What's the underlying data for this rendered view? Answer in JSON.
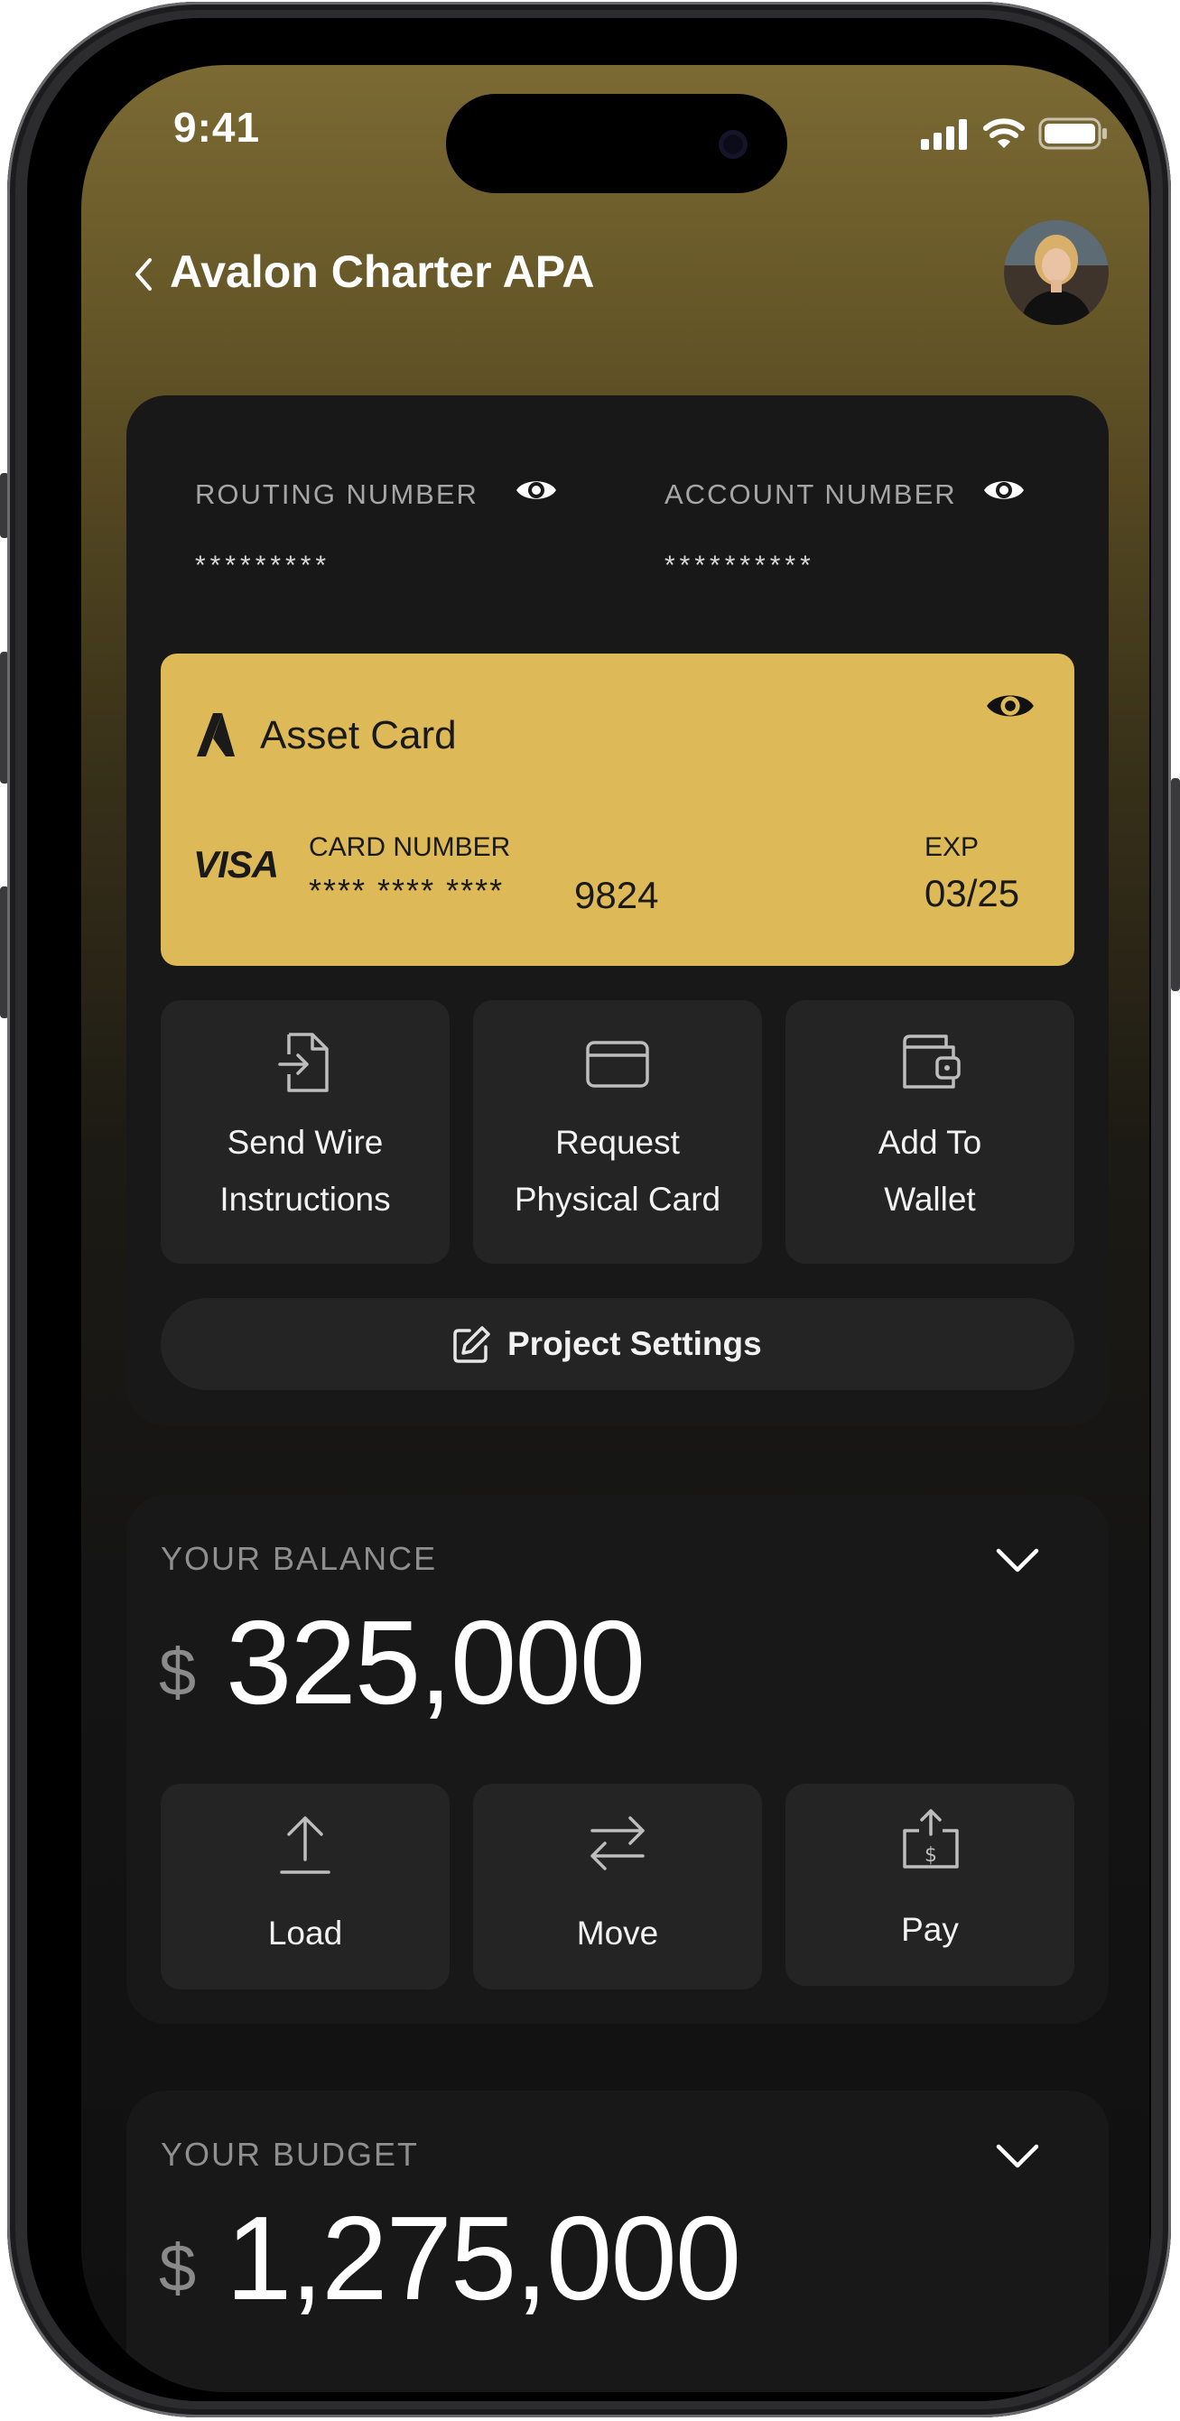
{
  "status_bar": {
    "time": "9:41"
  },
  "header": {
    "title": "Avalon Charter APA"
  },
  "account": {
    "routing_label": "ROUTING NUMBER",
    "routing_value": "*********",
    "account_label": "ACCOUNT NUMBER",
    "account_value": "**********"
  },
  "card": {
    "name": "Asset Card",
    "brand": "VISA",
    "number_label": "CARD NUMBER",
    "number_masked": "**** **** ****",
    "number_last4": "9824",
    "exp_label": "EXP",
    "exp_value": "03/25",
    "color": "#ddba57"
  },
  "card_actions": [
    {
      "label_line1": "Send Wire",
      "label_line2": "Instructions",
      "icon": "file-export-icon"
    },
    {
      "label_line1": "Request",
      "label_line2": "Physical Card",
      "icon": "credit-card-icon"
    },
    {
      "label_line1": "Add To",
      "label_line2": "Wallet",
      "icon": "wallet-icon"
    }
  ],
  "project_settings": {
    "label": "Project Settings",
    "icon": "edit-icon"
  },
  "balance": {
    "label": "YOUR BALANCE",
    "currency": "$",
    "amount": "325,000",
    "actions": [
      {
        "label": "Load",
        "icon": "upload-arrow-icon"
      },
      {
        "label": "Move",
        "icon": "transfer-arrows-icon"
      },
      {
        "label": "Pay",
        "icon": "pay-dollar-icon"
      }
    ]
  },
  "budget": {
    "label": "YOUR BUDGET",
    "currency": "$",
    "amount": "1,275,000"
  }
}
